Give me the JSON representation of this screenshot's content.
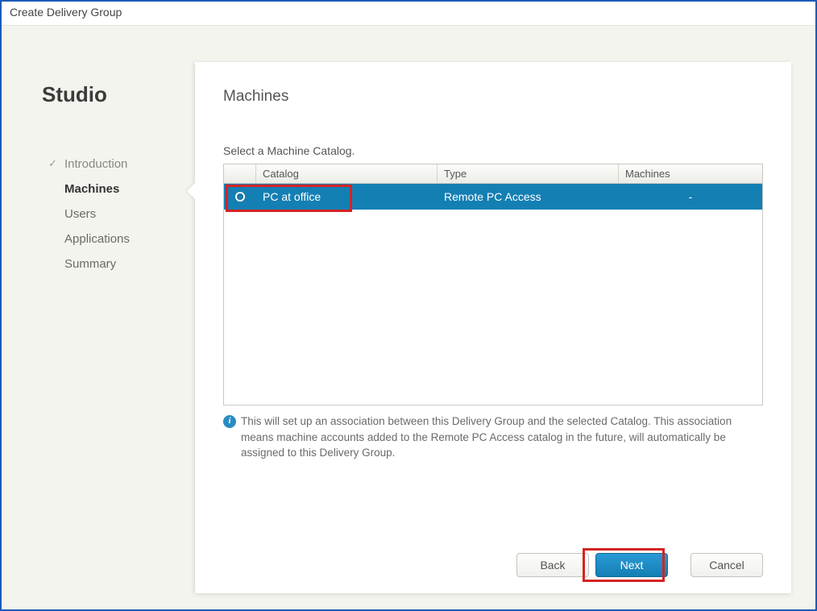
{
  "window": {
    "title": "Create Delivery Group"
  },
  "sidebar": {
    "brand": "Studio",
    "items": [
      {
        "label": "Introduction",
        "state": "completed"
      },
      {
        "label": "Machines",
        "state": "current"
      },
      {
        "label": "Users",
        "state": "pending"
      },
      {
        "label": "Applications",
        "state": "pending"
      },
      {
        "label": "Summary",
        "state": "pending"
      }
    ]
  },
  "main": {
    "heading": "Machines",
    "subheading": "Select a Machine Catalog.",
    "table": {
      "columns": {
        "catalog": "Catalog",
        "type": "Type",
        "machines": "Machines"
      },
      "rows": [
        {
          "catalog": "PC at office",
          "type": "Remote PC Access",
          "machines": "-",
          "selected": true
        }
      ]
    },
    "info_note": "This will set up an association between this Delivery Group and the selected Catalog. This association means machine accounts added to the Remote PC Access catalog in the future, will automatically be assigned to this Delivery Group.",
    "buttons": {
      "back": "Back",
      "next": "Next",
      "cancel": "Cancel"
    }
  },
  "highlights": [
    {
      "target": "catalog-row-cell"
    },
    {
      "target": "next-button"
    }
  ],
  "colors": {
    "accent_blue": "#147fb3",
    "window_border": "#1b5cb8",
    "highlight_red": "#d52323"
  }
}
